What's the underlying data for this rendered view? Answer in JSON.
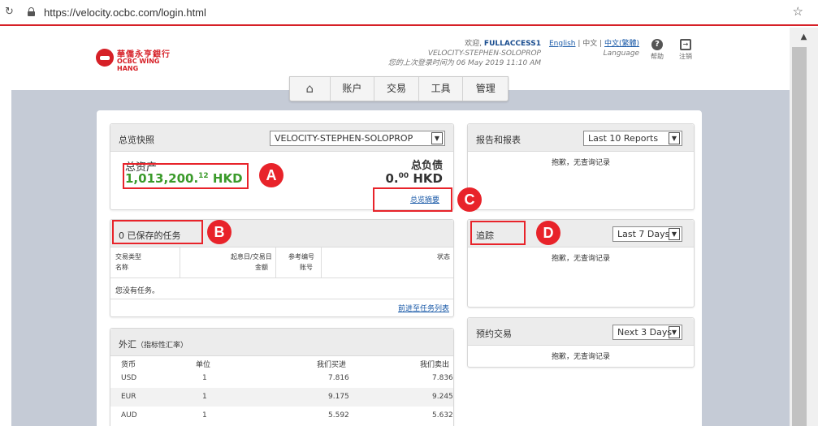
{
  "browser": {
    "url": "https://velocity.ocbc.com/login.html"
  },
  "header": {
    "logo_cn": "華僑永亨銀行",
    "logo_en": "OCBC WING HANG",
    "welcome_prefix": "欢迎,",
    "username": "FULLACCESS1",
    "account": "VELOCITY-STEPHEN-SOLOPROP",
    "last_login": "您的上次登录时间为 06 May 2019 11:10 AM",
    "lang_english": "English",
    "lang_sep1": " | ",
    "lang_simplified": "中文",
    "lang_sep2": " | ",
    "lang_traditional": "中文(繁體)",
    "lang_caption": "Language",
    "help_label": "帮助",
    "logout_label": "注销"
  },
  "nav": {
    "home_icon": "home-icon",
    "items": [
      "账户",
      "交易",
      "工具",
      "管理"
    ]
  },
  "summary": {
    "title": "总览快照",
    "account_select": "VELOCITY-STEPHEN-SOLOPROP",
    "assets_label": "总资产",
    "assets_main": "1,013,200.",
    "assets_cents": "12",
    "assets_ccy": " HKD",
    "liab_label": "总负债",
    "liab_main": "0.",
    "liab_cents": "00",
    "liab_ccy": " HKD",
    "link": "总览摘要"
  },
  "tasks": {
    "title": "0 已保存的任务",
    "col1a": "交易类型",
    "col1b": "名称",
    "col2a": "起息日/交易日",
    "col2b": "金额",
    "col3a": "参考编号",
    "col3b": "账号",
    "col4": "状态",
    "empty": "您没有任务。",
    "link": "前进至任务列表"
  },
  "fx": {
    "title": "外汇",
    "title_note": "（指标性汇率）",
    "headers": [
      "货币",
      "单位",
      "我们买进",
      "我们卖出"
    ],
    "rows": [
      {
        "ccy": "USD",
        "unit": "1",
        "buy": "7.816",
        "sell": "7.836"
      },
      {
        "ccy": "EUR",
        "unit": "1",
        "buy": "9.175",
        "sell": "9.245"
      },
      {
        "ccy": "AUD",
        "unit": "1",
        "buy": "5.592",
        "sell": "5.632"
      }
    ]
  },
  "reports": {
    "title": "报告和报表",
    "select": "Last 10 Reports",
    "empty": "抱歉，无查询记录"
  },
  "tracking": {
    "title": "追踪",
    "select": "Last 7 Days",
    "empty": "抱歉，无查询记录"
  },
  "scheduled": {
    "title": "预约交易",
    "select": "Next 3 Days",
    "empty": "抱歉，无查询记录"
  },
  "annotations": [
    "A",
    "B",
    "C",
    "D"
  ],
  "colors": {
    "brand_red": "#d62027",
    "annotation_red": "#e8232a",
    "asset_green": "#3a9a2a",
    "link_blue": "#1a5aa8"
  }
}
